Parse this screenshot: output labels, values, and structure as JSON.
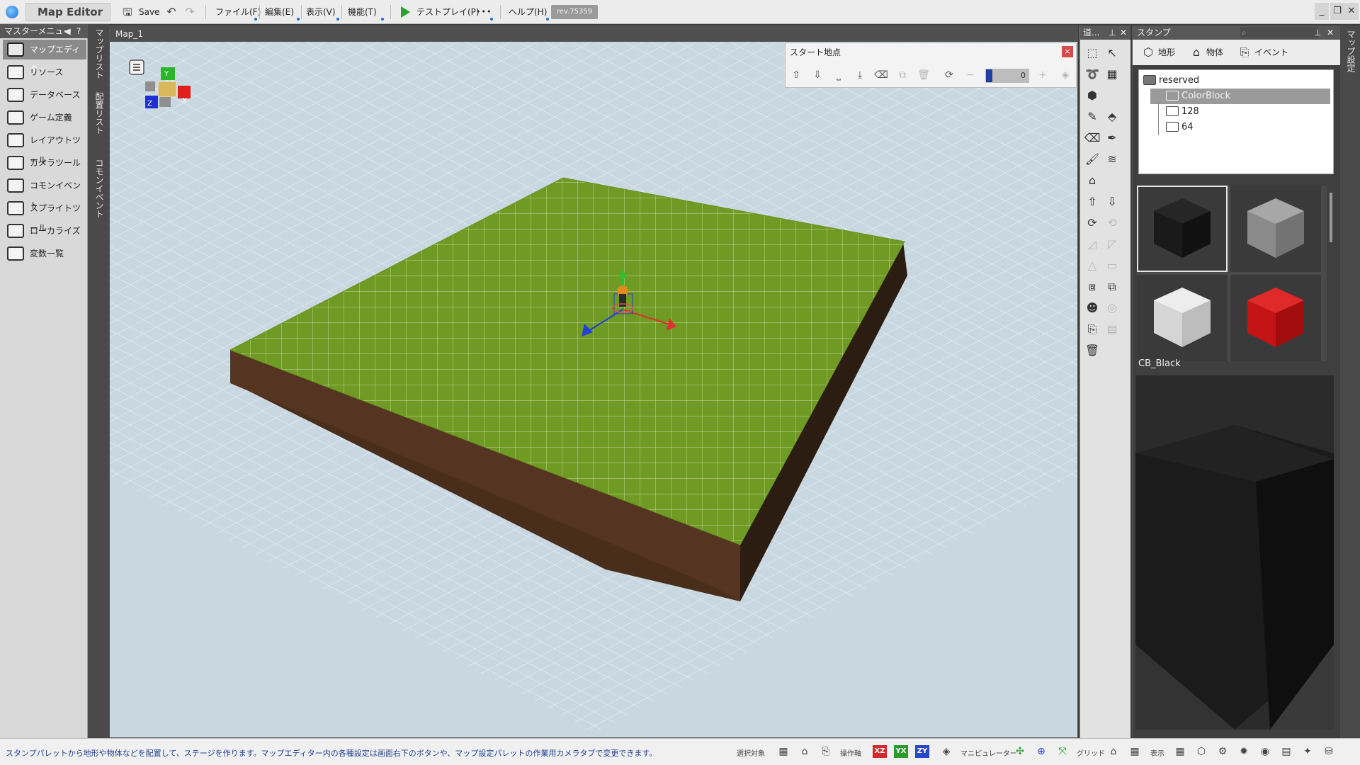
{
  "app": {
    "title": "Map Editor",
    "save_label": "Save",
    "revision": "rev.75359",
    "menus": [
      "ファイル(F)",
      "編集(E)",
      "表示(V)",
      "機能(T)"
    ],
    "test_play": "テストプレイ(P)",
    "more": "•••",
    "help": "ヘルプ(H)",
    "window_controls": [
      "_",
      "❐",
      "✕"
    ]
  },
  "master_menu": {
    "title": "マスターメニュー",
    "items": [
      {
        "label": "マップエディター",
        "active": true,
        "icon": "map-editor-icon"
      },
      {
        "label": "リソース",
        "active": false,
        "icon": "resource-icon"
      },
      {
        "label": "データベース",
        "active": false,
        "icon": "database-icon"
      },
      {
        "label": "ゲーム定義",
        "active": false,
        "icon": "game-definition-icon"
      },
      {
        "label": "レイアウトツール",
        "active": false,
        "icon": "layout-tool-icon"
      },
      {
        "label": "カメラツール",
        "active": false,
        "icon": "camera-tool-icon"
      },
      {
        "label": "コモンイベント",
        "active": false,
        "icon": "common-event-icon"
      },
      {
        "label": "スプライトツール",
        "active": false,
        "icon": "sprite-tool-icon"
      },
      {
        "label": "ローカライズ",
        "active": false,
        "icon": "localize-icon"
      },
      {
        "label": "変数一覧",
        "active": false,
        "icon": "variables-icon"
      }
    ]
  },
  "vertical_tabs": [
    "マップリスト",
    "配置リスト",
    "コモンイベント"
  ],
  "viewport": {
    "tab_title": "Map_1",
    "gizmo_axes": [
      "Y",
      "X",
      "Z"
    ]
  },
  "start_panel": {
    "title": "スタート地点",
    "close": "×",
    "value": "0"
  },
  "tools_panel": {
    "title": "道..."
  },
  "stamp_panel": {
    "title": "スタンプ",
    "tabs": [
      "地形",
      "物体",
      "イベント"
    ],
    "tree": {
      "root": "reserved",
      "selected": "ColorBlock",
      "children": [
        "128",
        "64"
      ]
    },
    "preview_label": "CB_Black",
    "thumbs": [
      {
        "name": "black-cube",
        "color": "#1c1c1c"
      },
      {
        "name": "gray-cube",
        "color": "#8c8c8c"
      },
      {
        "name": "white-cube",
        "color": "#d6d6d6"
      },
      {
        "name": "red-cube",
        "color": "#c21414"
      }
    ]
  },
  "right_strip": {
    "label": "マップ設定"
  },
  "status": {
    "message": "スタンプパレットから地形や物体などを配置して、ステージを作ります。マップエディター内の各種設定は画面右下のボタンや、マップ設定パレットの作業用カメラタブで変更できます。",
    "select_target": "選択対象",
    "operation_axis": "操作軸",
    "axes": [
      "XZ",
      "YX",
      "ZY"
    ],
    "manipulator": "マニピュレーター",
    "grid": "グリッド",
    "display": "表示"
  },
  "colors": {
    "grass": "#6f9a23",
    "soil": "#4a2e1c",
    "sky": "#c9d8e1",
    "accent_blue": "#1a73d9"
  }
}
